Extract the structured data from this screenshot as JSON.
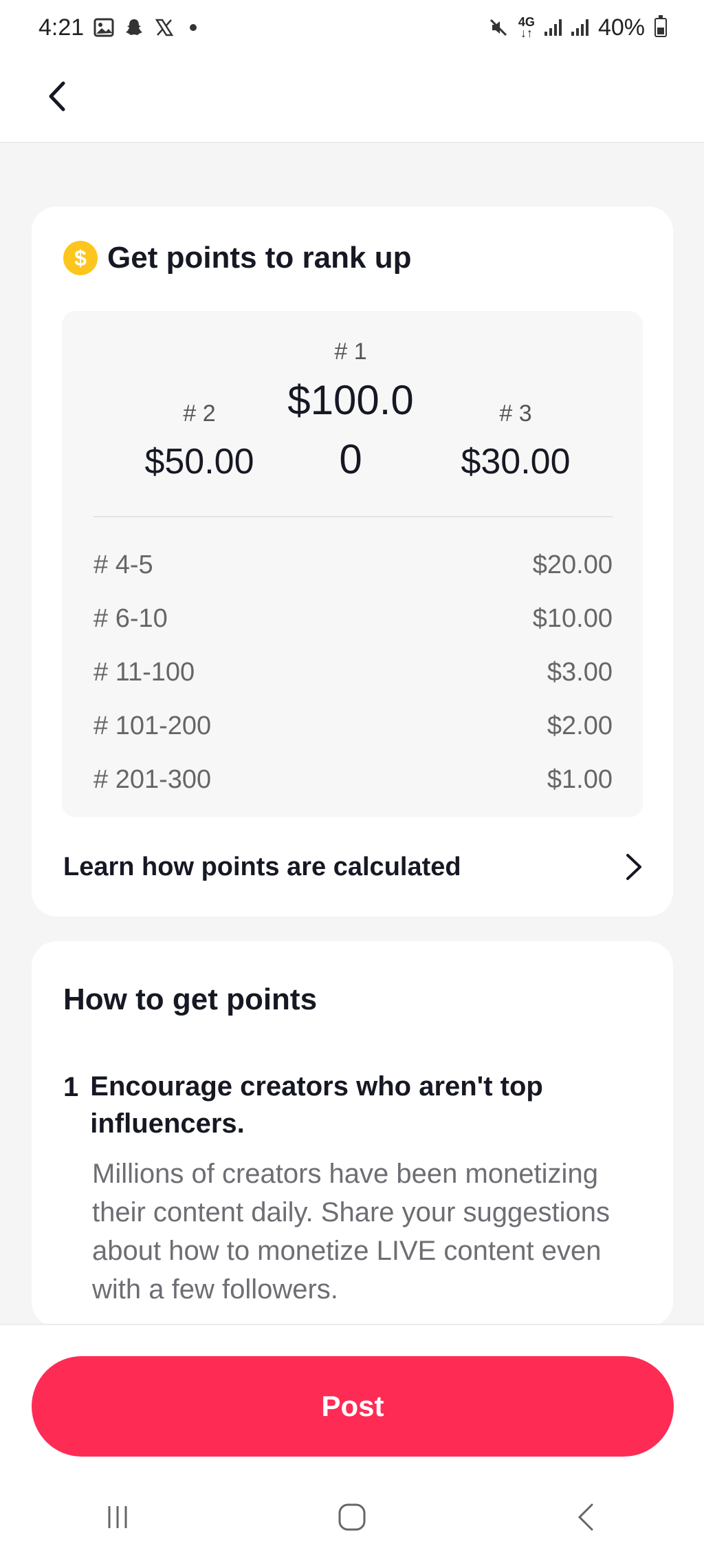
{
  "status_bar": {
    "time": "4:21",
    "network": "4G",
    "battery": "40%"
  },
  "rank_card": {
    "title": "Get points to rank up",
    "coin_symbol": "$",
    "podium": {
      "first": {
        "rank": "# 1",
        "value": "$100.00"
      },
      "second": {
        "rank": "# 2",
        "value": "$50.00"
      },
      "third": {
        "rank": "# 3",
        "value": "$30.00"
      }
    },
    "tiers": [
      {
        "rank": "# 4-5",
        "value": "$20.00"
      },
      {
        "rank": "# 6-10",
        "value": "$10.00"
      },
      {
        "rank": "# 11-100",
        "value": "$3.00"
      },
      {
        "rank": "# 101-200",
        "value": "$2.00"
      },
      {
        "rank": "# 201-300",
        "value": "$1.00"
      }
    ],
    "learn_link": "Learn how points are calculated"
  },
  "how_card": {
    "title": "How to get points",
    "step": {
      "number": "1",
      "title": "Encourage creators who aren't top influencers.",
      "description": "Millions of creators have been monetizing their content daily. Share your suggestions about how to monetize LIVE content even with a few followers."
    }
  },
  "actions": {
    "post_label": "Post"
  },
  "colors": {
    "accent": "#fe2c55",
    "coin": "#fcc61e"
  }
}
